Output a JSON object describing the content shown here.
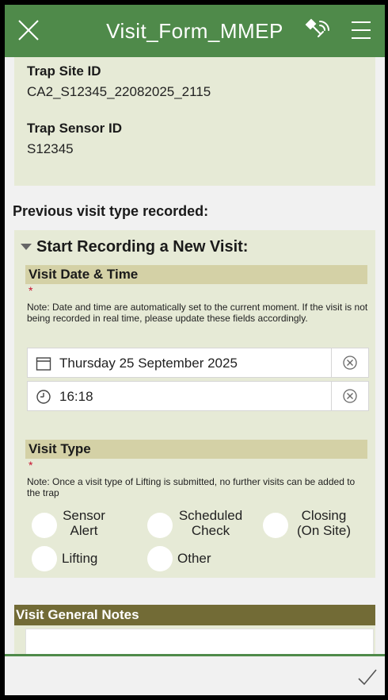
{
  "header": {
    "title": "Visit_Form_MMEP",
    "close_icon": "close-icon",
    "location_icon": "satellite-icon",
    "menu_icon": "menu-icon",
    "color": "#4f8a4a"
  },
  "site": {
    "trap_site_id_label": "Trap Site ID",
    "trap_site_id_value": "CA2_S12345_22082025_2115",
    "trap_sensor_id_label": "Trap Sensor ID",
    "trap_sensor_id_value": "S12345"
  },
  "previous_visit_label": "Previous visit type recorded:",
  "new_visit": {
    "group_title": "Start Recording a New Visit:",
    "datetime_label": "Visit Date & Time",
    "required_mark": "*",
    "datetime_note": "Note: Date and time are automatically set to the current moment. If the visit is not being recorded in real time, please update these fields accordingly.",
    "date_value": "Thursday 25 September 2025",
    "time_value": "16:18",
    "visit_type_label": "Visit Type",
    "visit_type_note": "Note: Once a visit type of Lifting is submitted, no further visits can be added to the trap",
    "options": {
      "sensor_alert_1": "Sensor",
      "sensor_alert_2": "Alert",
      "scheduled_check_1": "Scheduled",
      "scheduled_check_2": "Check",
      "closing_1": "Closing",
      "closing_2": "(On Site)",
      "lifting": "Lifting",
      "other": "Other"
    }
  },
  "general_notes": {
    "label": "Visit General Notes",
    "value": ""
  },
  "footer": {
    "submit_icon": "checkmark-icon"
  }
}
